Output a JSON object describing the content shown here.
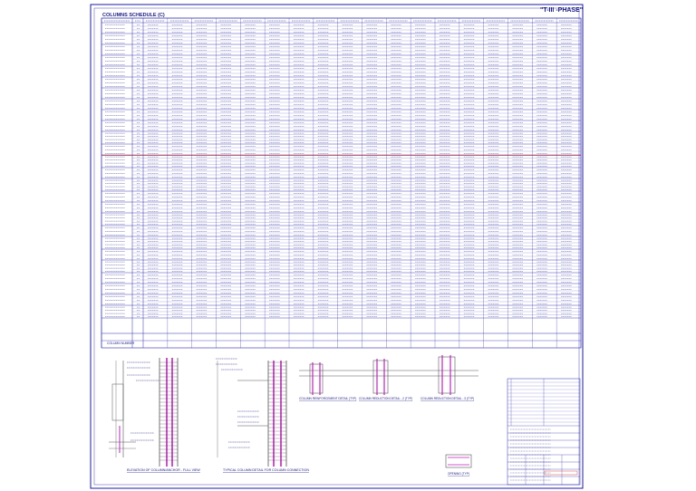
{
  "sheet": {
    "schedule_title": "COLUMNS SCHEDULE (C)",
    "phase_label": "\"T-III -PHASE\"",
    "bottom_row_label": "COLUMN NUMBER"
  },
  "colors": {
    "frame": "#1a1aa6",
    "grid": "#2a2ab0",
    "text": "#1a1a80",
    "highlight_line": "#cc2222",
    "rebar": "#c21fc2",
    "concrete": "#555555"
  },
  "details": {
    "elevation_caption": "ELEVATION OF COLUMN/ANCHOR - FULL VIEW",
    "typical_caption": "TYPICAL COLUMN DETAIL FOR COLUMN CONNECTION",
    "section1_caption": "COLUMN REINFORCEMENT DETAIL (TYP)",
    "section2_caption": "COLUMN REDUCTION DETAIL - 2 (TYP)",
    "section3_caption": "COLUMN REDUCTION DETAIL - 3 (TYP)",
    "opening_caption": "OPENING (TYP)"
  }
}
